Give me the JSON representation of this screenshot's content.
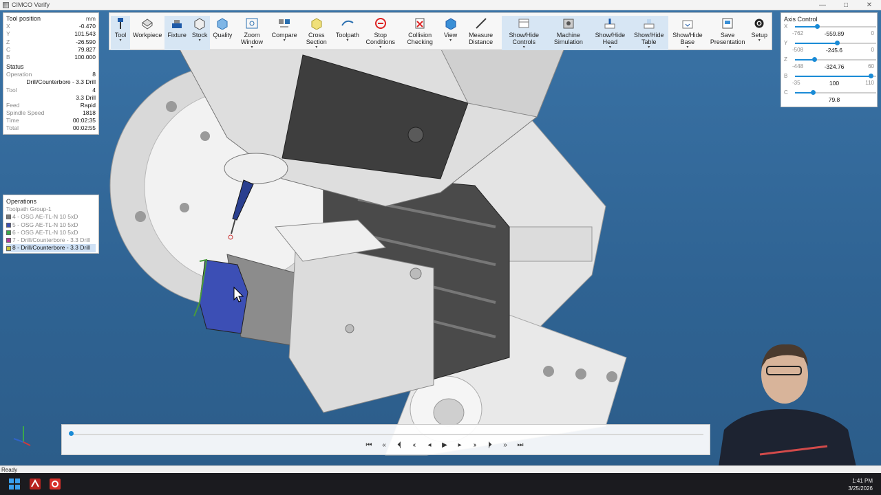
{
  "window": {
    "title": "CIMCO Verify",
    "minimize": "—",
    "maximize": "□",
    "close": "✕"
  },
  "toolbar": [
    {
      "label": "Tool",
      "icon": "tool-icon",
      "caret": true,
      "active": true
    },
    {
      "label": "Workpiece",
      "icon": "workpiece-icon",
      "caret": false,
      "active": false
    },
    {
      "label": "Fixture",
      "icon": "fixture-icon",
      "caret": false,
      "active": true
    },
    {
      "label": "Stock",
      "icon": "stock-icon",
      "caret": true,
      "active": true
    },
    {
      "label": "Quality",
      "icon": "quality-icon",
      "caret": false,
      "active": false
    },
    {
      "label": "Zoom Window",
      "icon": "zoom-window-icon",
      "caret": true,
      "active": false
    },
    {
      "label": "Compare",
      "icon": "compare-icon",
      "caret": true,
      "active": false
    },
    {
      "label": "Cross Section",
      "icon": "cross-section-icon",
      "caret": true,
      "active": false
    },
    {
      "label": "Toolpath",
      "icon": "toolpath-icon",
      "caret": true,
      "active": false
    },
    {
      "label": "Stop Conditions",
      "icon": "stop-conditions-icon",
      "caret": true,
      "active": false
    },
    {
      "label": "Collision Checking",
      "icon": "collision-checking-icon",
      "caret": false,
      "active": false
    },
    {
      "label": "View",
      "icon": "view-icon",
      "caret": true,
      "active": false
    },
    {
      "label": "Measure Distance",
      "icon": "measure-distance-icon",
      "caret": false,
      "active": false
    },
    {
      "label": "Show/Hide Controls",
      "icon": "show-hide-controls-icon",
      "caret": true,
      "active": true
    },
    {
      "label": "Machine Simulation",
      "icon": "machine-simulation-icon",
      "caret": false,
      "active": true
    },
    {
      "label": "Show/Hide Head",
      "icon": "show-hide-head-icon",
      "caret": true,
      "active": true
    },
    {
      "label": "Show/Hide Table",
      "icon": "show-hide-table-icon",
      "caret": true,
      "active": true
    },
    {
      "label": "Show/Hide Base",
      "icon": "show-hide-base-icon",
      "caret": true,
      "active": false
    },
    {
      "label": "Save Presentation",
      "icon": "save-presentation-icon",
      "caret": false,
      "active": false
    },
    {
      "label": "Setup",
      "icon": "setup-gear-icon",
      "caret": true,
      "active": false
    }
  ],
  "tool_position": {
    "title": "Tool position",
    "unit": "mm",
    "rows": [
      {
        "label": "X",
        "value": "-0.470"
      },
      {
        "label": "Y",
        "value": "101.543"
      },
      {
        "label": "Z",
        "value": "-26.590"
      },
      {
        "label": "C",
        "value": "79.827"
      },
      {
        "label": "B",
        "value": "100.000"
      }
    ],
    "status_title": "Status",
    "status_rows": [
      {
        "label": "Operation",
        "value": "8"
      },
      {
        "label": "",
        "value": "Drill/Counterbore - 3.3 Drill"
      },
      {
        "label": "Tool",
        "value": "4"
      },
      {
        "label": "",
        "value": "3.3 Drill"
      },
      {
        "label": "Feed",
        "value": "Rapid"
      },
      {
        "label": "Spindle Speed",
        "value": "1818"
      },
      {
        "label": "Time",
        "value": "00:02:35"
      },
      {
        "label": "Total",
        "value": "00:02:55"
      }
    ]
  },
  "operations": {
    "title": "Operations",
    "group": "Toolpath Group-1",
    "items": [
      {
        "label": "4 - OSG AE-TL-N 10 5xD",
        "color": "#7a7a7a",
        "selected": false
      },
      {
        "label": "5 - OSG AE-TL-N 10 5xD",
        "color": "#3d4fb0",
        "selected": false
      },
      {
        "label": "6 - OSG AE-TL-N 10 5xD",
        "color": "#3aa84a",
        "selected": false
      },
      {
        "label": "7 - Drill/Counterbore - 3.3 Drill",
        "color": "#b03a9c",
        "selected": false
      },
      {
        "label": "8 - Drill/Counterbore - 3.3 Drill",
        "color": "#c9c235",
        "selected": true
      }
    ]
  },
  "axis_control": {
    "title": "Axis Control",
    "axes": [
      {
        "label": "X",
        "min": "-762",
        "value": "-559.89",
        "max": "0",
        "fraction": 0.27
      },
      {
        "label": "Y",
        "min": "-508",
        "value": "-245.6",
        "max": "0",
        "fraction": 0.52
      },
      {
        "label": "Z",
        "min": "-448",
        "value": "-324.76",
        "max": "60",
        "fraction": 0.24
      },
      {
        "label": "B",
        "min": "-35",
        "value": "100",
        "max": "110",
        "fraction": 0.93
      },
      {
        "label": "C",
        "min": "",
        "value": "79.8",
        "max": "",
        "fraction": 0.22
      }
    ]
  },
  "playback": {
    "progress": 0.0,
    "buttons": [
      "skip-to-start",
      "step-back-fast",
      "previous-operation",
      "step-back",
      "play-reverse",
      "play",
      "play-forward",
      "step-forward",
      "next-operation",
      "step-forward-fast",
      "skip-to-end"
    ],
    "glyphs": [
      "⏮",
      "«",
      "⏴|",
      "‹‹",
      "◂",
      "▶",
      "▸",
      "››",
      "|⏵",
      "»",
      "⏭"
    ]
  },
  "status": {
    "text": "Ready"
  },
  "taskbar": {
    "time": "1:41 PM",
    "date": "3/25/2026"
  },
  "colors": {
    "accent": "#1a8bd6",
    "viewport": "#3a73a6",
    "toolbar_active": "#d7e6f4"
  }
}
